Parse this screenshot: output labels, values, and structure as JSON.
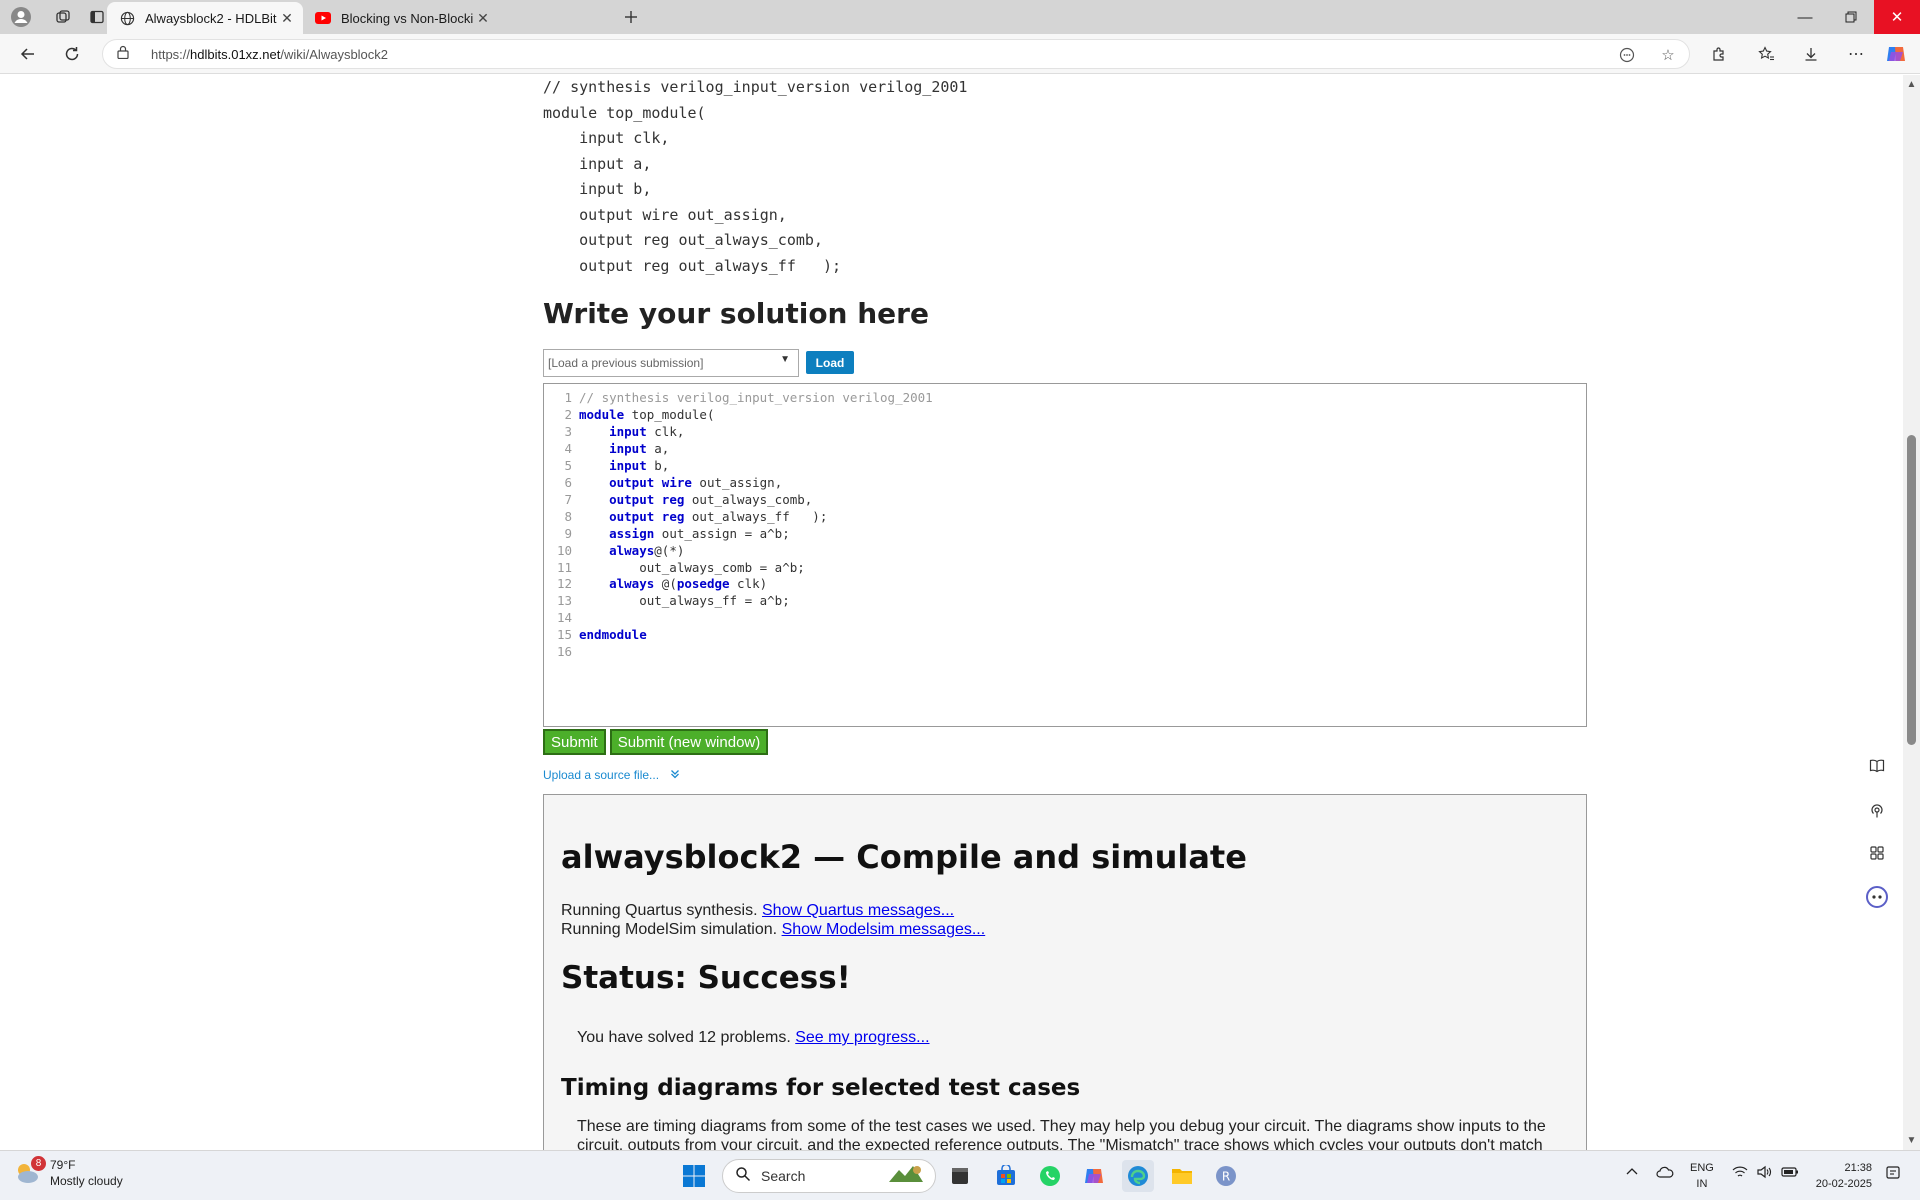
{
  "browser": {
    "tabs": [
      {
        "title": "Alwaysblock2 - HDLBits",
        "active": true,
        "favicon": "globe-icon"
      },
      {
        "title": "Blocking vs Non-Blocking Assignm",
        "active": false,
        "favicon": "youtube-icon"
      }
    ],
    "url_prefix": "https://",
    "url_host": "hdlbits.01xz.net",
    "url_path": "/wiki/Alwaysblock2"
  },
  "page": {
    "interface_code": [
      "// synthesis verilog_input_version verilog_2001",
      "module top_module(",
      "    input clk,",
      "    input a,",
      "    input b,",
      "    output wire out_assign,",
      "    output reg out_always_comb,",
      "    output reg out_always_ff   );"
    ],
    "solution_heading": "Write your solution here",
    "load_select_placeholder": "[Load a previous submission]",
    "load_button": "Load",
    "editor_lines": [
      [
        {
          "t": "// synthesis verilog_input_version verilog_2001",
          "c": "cm"
        }
      ],
      [
        {
          "t": "module",
          "c": "kw"
        },
        {
          "t": " top_module("
        }
      ],
      [
        {
          "t": "    "
        },
        {
          "t": "input",
          "c": "kw"
        },
        {
          "t": " clk,"
        }
      ],
      [
        {
          "t": "    "
        },
        {
          "t": "input",
          "c": "kw"
        },
        {
          "t": " a,"
        }
      ],
      [
        {
          "t": "    "
        },
        {
          "t": "input",
          "c": "kw"
        },
        {
          "t": " b,"
        }
      ],
      [
        {
          "t": "    "
        },
        {
          "t": "output",
          "c": "kw"
        },
        {
          "t": " "
        },
        {
          "t": "wire",
          "c": "kw"
        },
        {
          "t": " out_assign,"
        }
      ],
      [
        {
          "t": "    "
        },
        {
          "t": "output",
          "c": "kw"
        },
        {
          "t": " "
        },
        {
          "t": "reg",
          "c": "kw"
        },
        {
          "t": " out_always_comb,"
        }
      ],
      [
        {
          "t": "    "
        },
        {
          "t": "output",
          "c": "kw"
        },
        {
          "t": " "
        },
        {
          "t": "reg",
          "c": "kw"
        },
        {
          "t": " out_always_ff   );"
        }
      ],
      [
        {
          "t": "    "
        },
        {
          "t": "assign",
          "c": "kw"
        },
        {
          "t": " out_assign = a^b;"
        }
      ],
      [
        {
          "t": "    "
        },
        {
          "t": "always",
          "c": "kw"
        },
        {
          "t": "@(*)"
        }
      ],
      [
        {
          "t": "        out_always_comb = a^b;"
        }
      ],
      [
        {
          "t": "    "
        },
        {
          "t": "always",
          "c": "kw"
        },
        {
          "t": " @("
        },
        {
          "t": "posedge",
          "c": "kw"
        },
        {
          "t": " clk)"
        }
      ],
      [
        {
          "t": "        out_always_ff = a^b;"
        }
      ],
      [
        {
          "t": ""
        }
      ],
      [
        {
          "t": "endmodule",
          "c": "kw"
        }
      ],
      [
        {
          "t": ""
        }
      ]
    ],
    "submit_button": "Submit",
    "submit_new_window_button": "Submit (new window)",
    "upload_link": "Upload a source file...",
    "results": {
      "title": "alwaysblock2 — Compile and simulate",
      "quartus_text": "Running Quartus synthesis.",
      "quartus_link": "Show Quartus messages...",
      "modelsim_text": "Running ModelSim simulation.",
      "modelsim_link": "Show Modelsim messages...",
      "status": "Status: Success!",
      "solved_text": "You have solved 12 problems.",
      "progress_link": "See my progress...",
      "timing_heading": "Timing diagrams for selected test cases",
      "timing_text": "These are timing diagrams from some of the test cases we used. They may help you debug your circuit. The diagrams show inputs to the circuit, outputs from your circuit, and the expected reference outputs. The \"Mismatch\" trace shows which cycles your outputs don't match the reference outputs (o = correct, x = incorrect)."
    }
  },
  "taskbar": {
    "weather_temp": "79°F",
    "weather_desc": "Mostly cloudy",
    "weather_badge": "8",
    "search_placeholder": "Search",
    "lang_line1": "ENG",
    "lang_line2": "IN",
    "time": "21:38",
    "date": "20-02-2025"
  }
}
